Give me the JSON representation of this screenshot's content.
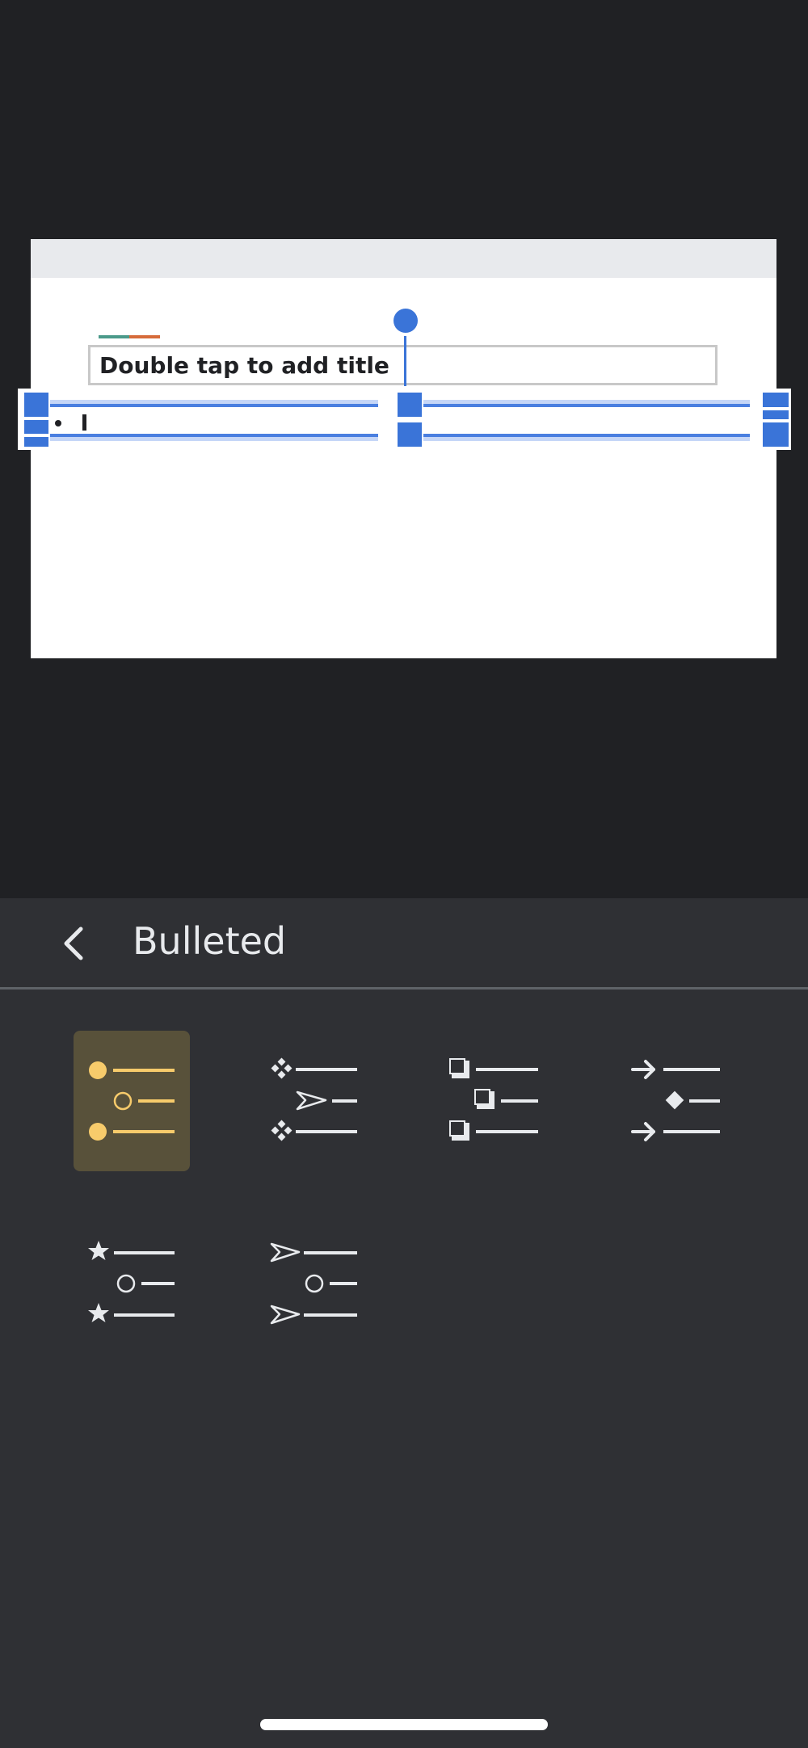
{
  "slide": {
    "title_placeholder": "Double tap to add title"
  },
  "panel": {
    "title": "Bulleted",
    "back_icon": "chevron-left-icon"
  },
  "bullet_options": [
    {
      "name": "filled-circle-hollow-circle",
      "selected": true
    },
    {
      "name": "diamond-arrowhead",
      "selected": false
    },
    {
      "name": "shadowed-square",
      "selected": false
    },
    {
      "name": "arrow-diamond",
      "selected": false
    },
    {
      "name": "star-hollow-circle",
      "selected": false
    },
    {
      "name": "arrowhead-hollow-circle",
      "selected": false
    }
  ],
  "colors": {
    "background": "#202124",
    "panel": "#2f3034",
    "selection_blue": "#3a74d8",
    "selected_tile": "#58513a",
    "selected_glyph": "#f7cb6b",
    "glyph": "#e8eaed"
  }
}
